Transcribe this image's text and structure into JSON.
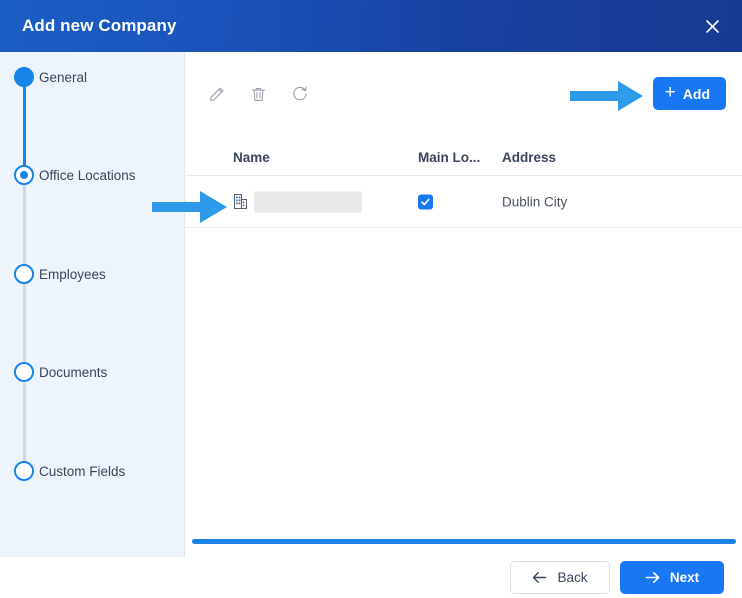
{
  "window": {
    "title": "Add new Company",
    "close_icon": "close-icon"
  },
  "sidebar": {
    "steps": [
      {
        "label": "General",
        "state": "done",
        "marker_icon": "step-dot-filled-icon"
      },
      {
        "label": "Office Locations",
        "state": "current",
        "marker_icon": "step-dot-current-icon"
      },
      {
        "label": "Employees",
        "state": "todo",
        "marker_icon": "step-dot-empty-icon"
      },
      {
        "label": "Documents",
        "state": "todo",
        "marker_icon": "step-dot-empty-icon"
      },
      {
        "label": "Custom Fields",
        "state": "todo",
        "marker_icon": "step-dot-empty-icon"
      }
    ]
  },
  "toolbar": {
    "edit_icon": "pencil-icon",
    "delete_icon": "trash-icon",
    "refresh_icon": "refresh-icon",
    "add_label": "Add",
    "add_plus": "+"
  },
  "table": {
    "columns": [
      "Name",
      "Main Lo...",
      "Address"
    ],
    "rows": [
      {
        "name": "",
        "name_redacted": true,
        "name_icon": "building-icon",
        "main_location": true,
        "address": "Dublin City"
      }
    ]
  },
  "progress": {
    "percent": 100
  },
  "footer": {
    "back_label": "Back",
    "back_icon": "arrow-left-icon",
    "next_label": "Next",
    "next_icon": "arrow-right-icon"
  },
  "annotations": [
    {
      "name": "arrow-pointing-to-add-button",
      "direction": "right",
      "color": "#2e9bea"
    },
    {
      "name": "arrow-pointing-to-table-row",
      "direction": "right",
      "color": "#2e9bea"
    }
  ],
  "colors": {
    "header_gradient_start": "#1b5ec4",
    "header_gradient_end": "#183a92",
    "accent": "#1877f2",
    "sidebar_bg": "#edf4fc",
    "step_blue": "#1784e8",
    "progress": "#1b83e3",
    "redaction": "#e9e9e9"
  }
}
